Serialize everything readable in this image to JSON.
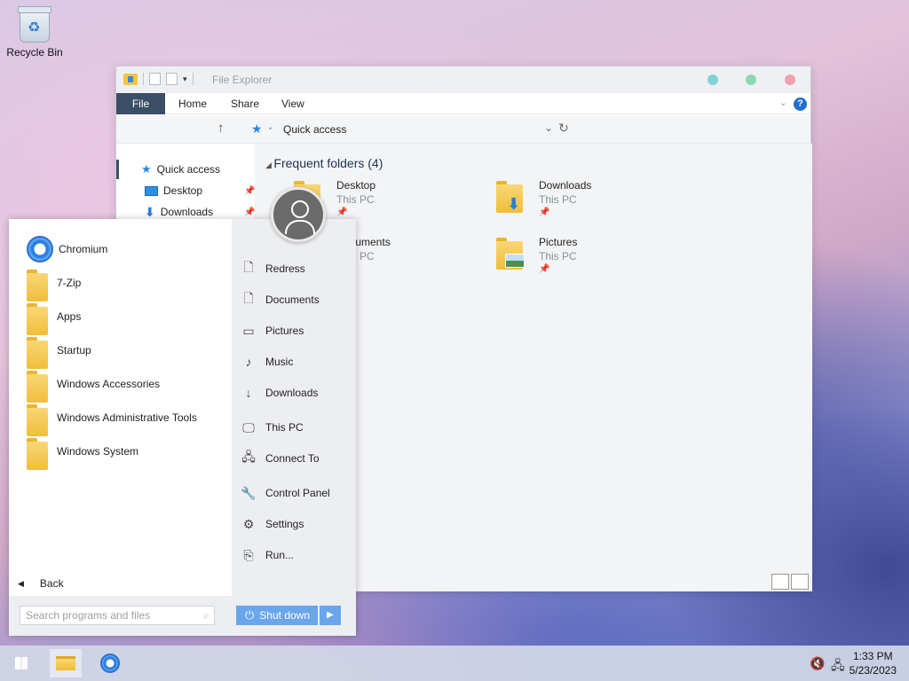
{
  "desktop": {
    "recycle_bin": "Recycle Bin"
  },
  "explorer": {
    "title": "File Explorer",
    "ribbon_tabs": [
      "File",
      "Home",
      "Share",
      "View"
    ],
    "help": "?",
    "breadcrumb": "Quick access",
    "nav_items": [
      "Quick access",
      "Desktop",
      "Downloads"
    ],
    "group_header": "Frequent folders (4)",
    "folders": [
      {
        "name": "Desktop",
        "location": "This PC"
      },
      {
        "name": "Downloads",
        "location": "This PC"
      },
      {
        "name": "Documents",
        "location": "This PC"
      },
      {
        "name": "Pictures",
        "location": "This PC"
      }
    ]
  },
  "start_menu": {
    "programs": [
      "Chromium",
      "7-Zip",
      "Apps",
      "Startup",
      "Windows Accessories",
      "Windows Administrative Tools",
      "Windows System"
    ],
    "back_label": "Back",
    "right_links": [
      "Redress",
      "Documents",
      "Pictures",
      "Music",
      "Downloads",
      "This PC",
      "Connect To",
      "Control Panel",
      "Settings",
      "Run..."
    ],
    "search_placeholder": "Search programs and files",
    "shutdown_label": "Shut down"
  },
  "taskbar": {
    "time": "1:33 PM",
    "date": "5/23/2023"
  },
  "colors": {
    "ribbon_file": "#3a4e66",
    "accent": "#6aa6ec",
    "dot_min": "#7fd3d6",
    "dot_max": "#8fd9b0",
    "dot_close": "#f0a0b0"
  }
}
